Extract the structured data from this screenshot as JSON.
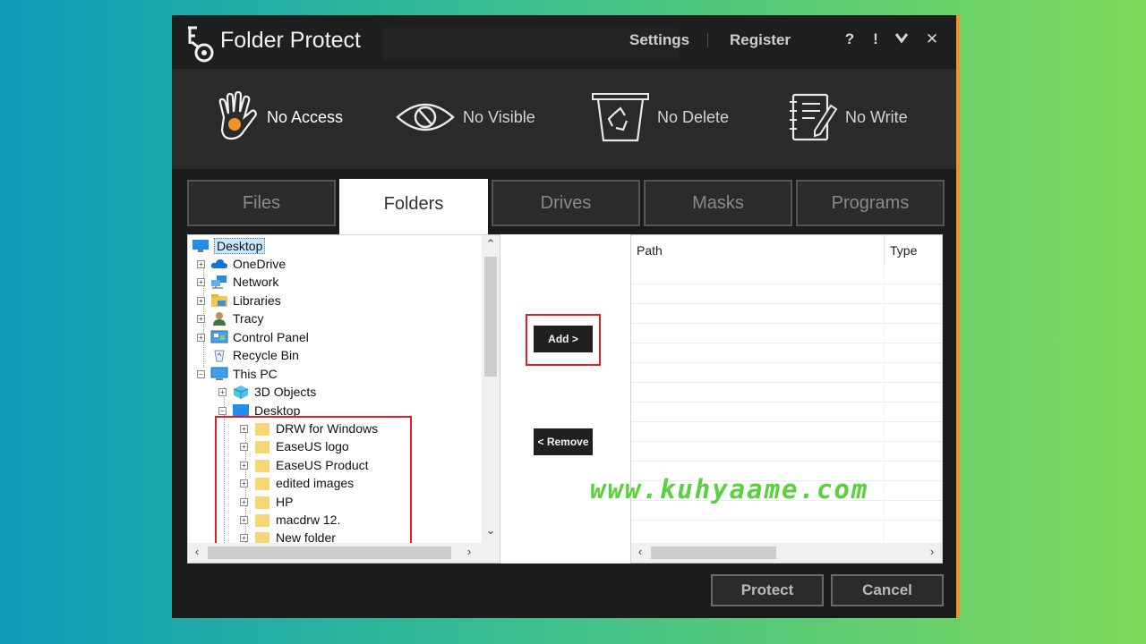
{
  "app": {
    "title": "Folder Protect"
  },
  "menu": {
    "settings": "Settings",
    "register": "Register"
  },
  "window_buttons": {
    "help": "?",
    "info": "!",
    "minimize": "⮟",
    "close": "✕"
  },
  "modes": [
    {
      "label": "No Access",
      "icon": "hand-icon"
    },
    {
      "label": "No Visible",
      "icon": "eye-slash-icon"
    },
    {
      "label": "No Delete",
      "icon": "recycle-bin-icon"
    },
    {
      "label": "No Write",
      "icon": "notepad-icon"
    }
  ],
  "tabs": [
    {
      "label": "Files"
    },
    {
      "label": "Folders",
      "active": true
    },
    {
      "label": "Drives"
    },
    {
      "label": "Masks"
    },
    {
      "label": "Programs"
    }
  ],
  "tree": {
    "items": [
      {
        "label": "Desktop",
        "selected": true
      },
      {
        "label": "OneDrive"
      },
      {
        "label": "Network"
      },
      {
        "label": "Libraries"
      },
      {
        "label": "Tracy"
      },
      {
        "label": "Control Panel"
      },
      {
        "label": "Recycle Bin"
      },
      {
        "label": "This PC"
      },
      {
        "label": "3D Objects"
      },
      {
        "label": "Desktop"
      },
      {
        "label": "DRW for Windows"
      },
      {
        "label": "EaseUS logo"
      },
      {
        "label": "EaseUS Product"
      },
      {
        "label": "edited images"
      },
      {
        "label": "HP"
      },
      {
        "label": "macdrw 12."
      },
      {
        "label": "New folder"
      }
    ]
  },
  "actions": {
    "add": "Add >",
    "remove": "< Remove"
  },
  "list": {
    "columns": [
      "Path",
      "Type"
    ]
  },
  "buttons": {
    "protect": "Protect",
    "cancel": "Cancel"
  },
  "watermark": "www.kuhyaame.com",
  "colors": {
    "accent": "#f2922b",
    "highlight_box": "#e02020",
    "watermark": "#58d13c"
  }
}
